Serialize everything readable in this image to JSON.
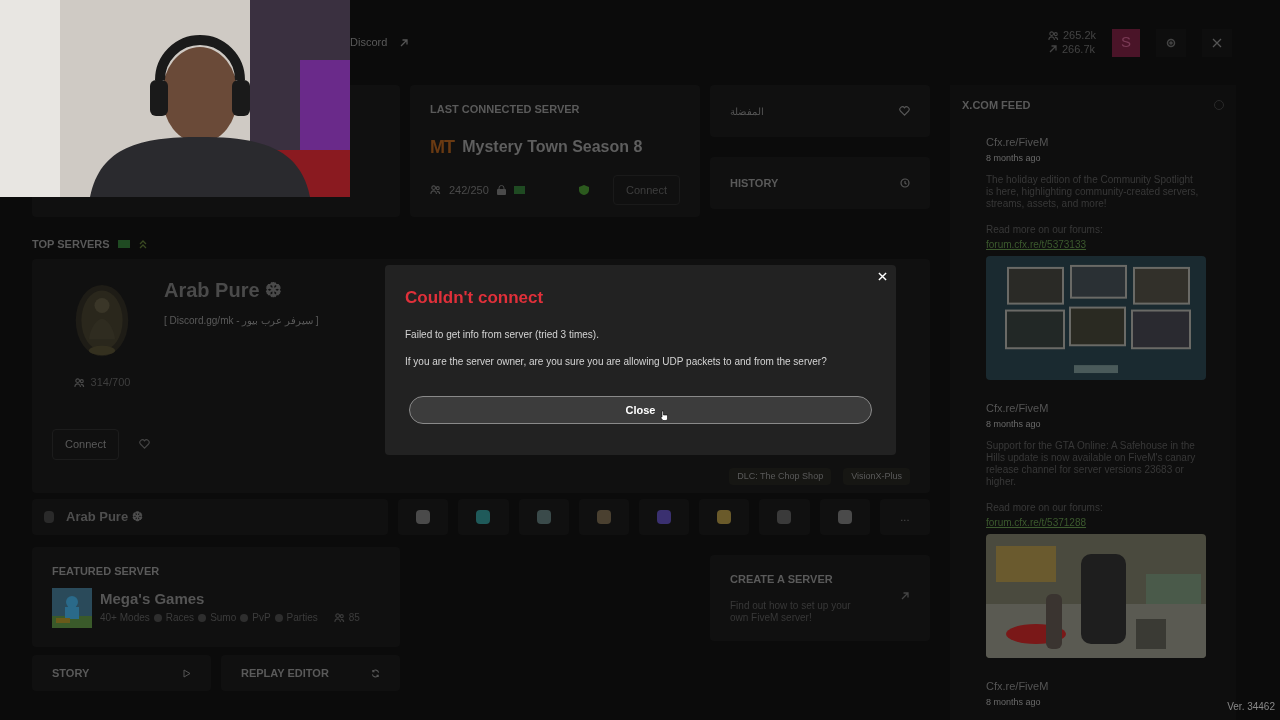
{
  "header": {
    "discord_link": "Discord",
    "players_online": "265.2k",
    "players_peak": "266.7k",
    "avatar_letter": "S"
  },
  "last_connected": {
    "label": "LAST CONNECTED SERVER",
    "logo": "MT",
    "name": "Mystery Town Season 8",
    "players": "242/250",
    "connect": "Connect"
  },
  "favorites": {
    "label": "المفضلة"
  },
  "history": {
    "label": "HISTORY"
  },
  "top_servers": {
    "label": "TOP SERVERS",
    "expanded": true,
    "name": "Arab Pure ❆",
    "description": "[ Discord.gg/mk - سيرفر عرب بيور ]",
    "players": "314/700",
    "connect": "Connect",
    "tags": [
      "DLC: The Chop Shop",
      "VisionX-Plus"
    ]
  },
  "server_strip": {
    "name": "Arab Pure ❆",
    "icons": [
      {
        "color": "#4a4a4a"
      },
      {
        "color": "#1f5a5a"
      },
      {
        "color": "#3a4a4a"
      },
      {
        "color": "#4a4030"
      },
      {
        "color": "#3a3070"
      },
      {
        "color": "#6a5a2a"
      },
      {
        "color": "#3a3a3a"
      },
      {
        "color": "#4a4a4a"
      }
    ],
    "more": "..."
  },
  "featured": {
    "label": "FEATURED SERVER",
    "name": "Mega's Games",
    "tags": [
      "40+ Modes",
      "Races",
      "Sumo",
      "PvP",
      "Parties"
    ],
    "players": "85"
  },
  "create_server": {
    "title": "CREATE A SERVER",
    "text": "Find out how to set up your own FiveM server!"
  },
  "bottom_buttons": [
    {
      "label": "STORY",
      "kind": "play"
    },
    {
      "label": "REPLAY EDITOR",
      "kind": "replay"
    }
  ],
  "feed": {
    "title": "X.COM FEED",
    "posts": [
      {
        "author": "Cfx.re/FiveM",
        "time": "8 months ago",
        "text": "The holiday edition of the Community Spotlight is here, highlighting community-created servers, streams, assets, and more!",
        "read_more": "Read more on our forums:",
        "link": "forum.cfx.re/t/5373133"
      },
      {
        "author": "Cfx.re/FiveM",
        "time": "8 months ago",
        "text": "Support for the GTA Online: A Safehouse in the Hills update is now available on FiveM's canary release channel for server versions 23683 or higher.",
        "read_more": "Read more on our forums:",
        "link": "forum.cfx.re/t/5371288"
      },
      {
        "author": "Cfx.re/FiveM",
        "time": "8 months ago"
      }
    ]
  },
  "version": "Ver. 34462",
  "dialog": {
    "title": "Couldn't connect",
    "messages": [
      "Failed to get info from server (tried 3 times).",
      "If you are the server owner, are you sure you are allowing UDP packets to and from the server?"
    ],
    "button": "Close"
  }
}
